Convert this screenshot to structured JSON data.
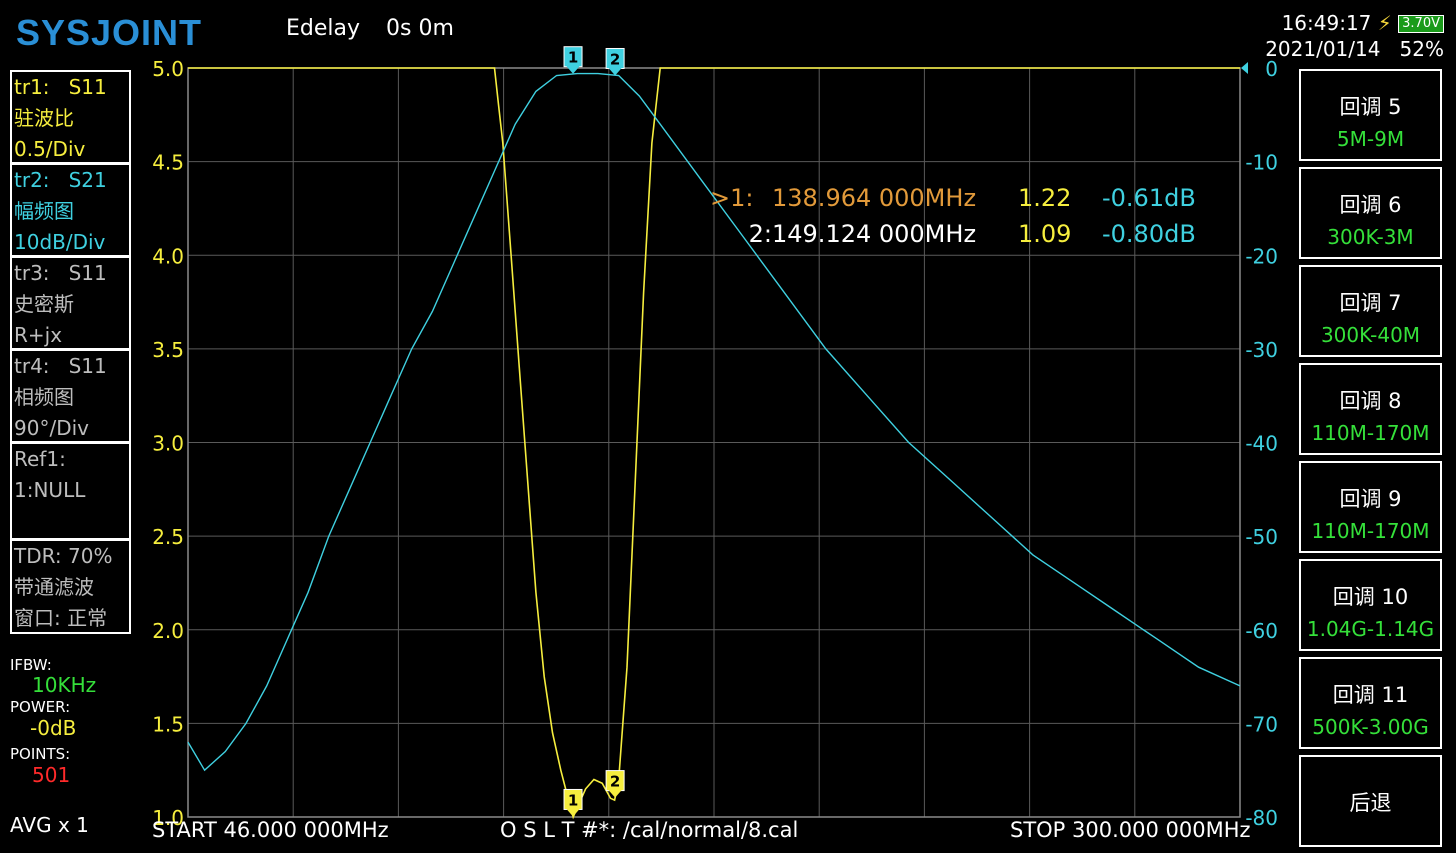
{
  "header": {
    "logo": "SYSJOINT",
    "edelay_label": "Edelay",
    "edelay_value": "0s 0m",
    "time": "16:49:17",
    "date": "2021/01/14",
    "battery_voltage": "3.70V",
    "battery_percent": "52%"
  },
  "traces": [
    {
      "id": "tr1:",
      "param": "S11",
      "format": "驻波比",
      "scale": "0.5/Div",
      "color": "#f6ee3e"
    },
    {
      "id": "tr2:",
      "param": "S21",
      "format": "幅频图",
      "scale": "10dB/Div",
      "color": "#3fd0e0"
    },
    {
      "id": "tr3:",
      "param": "S11",
      "format": "史密斯",
      "scale": "R+jx",
      "color": "#bdbdbd"
    },
    {
      "id": "tr4:",
      "param": "S11",
      "format": "相频图",
      "scale": "90°/Div",
      "color": "#bdbdbd"
    }
  ],
  "ref": {
    "line1": "Ref1:",
    "line2": "1:NULL"
  },
  "tdr": {
    "line1": "TDR: 70%",
    "line2": "带通滤波",
    "line3": "窗口: 正常"
  },
  "settings": {
    "ifbw_label": "IFBW:",
    "ifbw_value": "10KHz",
    "power_label": "POWER:",
    "power_value": "-0dB",
    "points_label": "POINTS:",
    "points_value": "501",
    "avg": "AVG x 1"
  },
  "footer": {
    "start": "START   46.000 000MHz",
    "cal": "O S L T #*: /cal/normal/8.cal",
    "stop": "STOP  300.000 000MHz"
  },
  "markers": [
    {
      "label": ">1:",
      "freq": "138.964 000MHz",
      "swr": "1.22",
      "s21": "-0.61dB",
      "color": "#e29a3a"
    },
    {
      "label": "2:",
      "freq": "149.124 000MHz",
      "swr": "1.09",
      "s21": "-0.80dB",
      "color": "#ffffff"
    }
  ],
  "buttons": [
    {
      "title": "回调 5",
      "value": "5M-9M"
    },
    {
      "title": "回调 6",
      "value": "300K-3M"
    },
    {
      "title": "回调 7",
      "value": "300K-40M"
    },
    {
      "title": "回调 8",
      "value": "110M-170M"
    },
    {
      "title": "回调 9",
      "value": "110M-170M"
    },
    {
      "title": "回调 10",
      "value": "1.04G-1.14G"
    },
    {
      "title": "回调 11",
      "value": "500K-3.00G"
    },
    {
      "title": "后退",
      "value": ""
    }
  ],
  "chart_data": {
    "type": "line",
    "x_range_mhz": [
      46,
      300
    ],
    "left_axis": {
      "ticks": [
        "5.0",
        "4.5",
        "4.0",
        "3.5",
        "3.0",
        "2.5",
        "2.0",
        "1.5",
        "1.0"
      ],
      "ylim": [
        1.0,
        5.0
      ]
    },
    "right_axis": {
      "ticks": [
        "0",
        "-10",
        "-20",
        "-30",
        "-40",
        "-50",
        "-60",
        "-70",
        "-80"
      ],
      "ylim": [
        -80,
        0
      ]
    },
    "grid": true,
    "series": [
      {
        "trace": "tr1",
        "axis": "left",
        "color": "#f6ee3e",
        "x": [
          46,
          120,
          121,
          122,
          124,
          126,
          128,
          130,
          132,
          134,
          136,
          138,
          139,
          140,
          142,
          144,
          146,
          148,
          149,
          150,
          152,
          154,
          156,
          158,
          160,
          300
        ],
        "y": [
          5.0,
          5.0,
          4.8,
          4.6,
          4.0,
          3.4,
          2.8,
          2.2,
          1.75,
          1.45,
          1.25,
          1.08,
          1.0,
          1.05,
          1.15,
          1.2,
          1.18,
          1.1,
          1.09,
          1.2,
          1.8,
          2.8,
          3.8,
          4.6,
          5.0,
          5.0
        ]
      },
      {
        "trace": "tr2",
        "axis": "right",
        "color": "#3fd0e0",
        "x": [
          46,
          50,
          55,
          60,
          65,
          70,
          75,
          80,
          85,
          90,
          95,
          100,
          105,
          110,
          115,
          120,
          125,
          130,
          135,
          140,
          145,
          150,
          155,
          160,
          170,
          180,
          190,
          200,
          210,
          220,
          230,
          240,
          250,
          260,
          270,
          280,
          290,
          300
        ],
        "y": [
          -72,
          -75,
          -73,
          -70,
          -66,
          -61,
          -56,
          -50,
          -45,
          -40,
          -35,
          -30,
          -26,
          -21,
          -16,
          -11,
          -6,
          -2.5,
          -0.8,
          -0.6,
          -0.6,
          -0.8,
          -3,
          -6,
          -12,
          -18,
          -24,
          -30,
          -35,
          -40,
          -44,
          -48,
          -52,
          -55,
          -58,
          -61,
          -64,
          -66
        ]
      }
    ],
    "marker_positions": [
      {
        "id": "1",
        "x": 138.964,
        "swr": 1.22,
        "s21_db": -0.61
      },
      {
        "id": "2",
        "x": 149.124,
        "swr": 1.09,
        "s21_db": -0.8
      }
    ]
  }
}
